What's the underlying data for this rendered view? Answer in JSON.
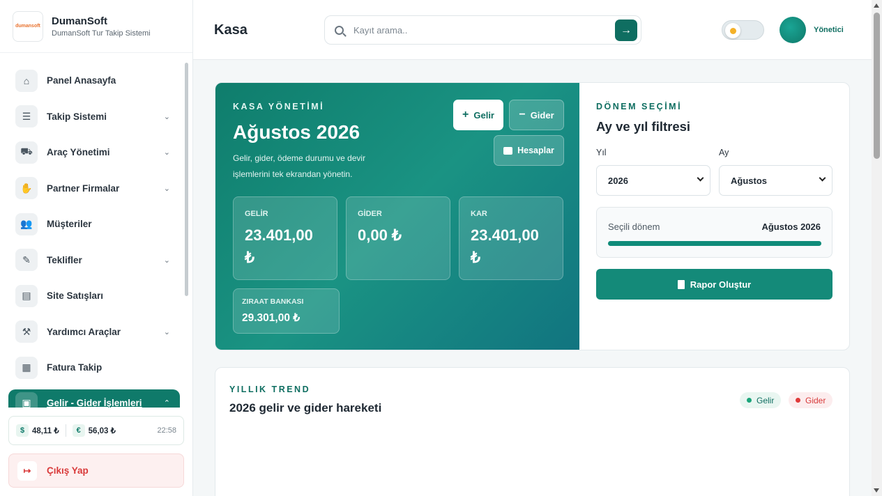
{
  "brand": {
    "logo_text": "dumansoft",
    "name": "DumanSoft",
    "subtitle": "DumanSoft Tur Takip Sistemi"
  },
  "sidebar": {
    "items": [
      {
        "label": "Panel Anasayfa",
        "icon": "home-icon",
        "glyph": "⌂",
        "chevron": ""
      },
      {
        "label": "Takip Sistemi",
        "icon": "list-icon",
        "glyph": "☰",
        "chevron": "⌄"
      },
      {
        "label": "Araç Yönetimi",
        "icon": "car-icon",
        "glyph": "⛟",
        "chevron": "⌄"
      },
      {
        "label": "Partner Firmalar",
        "icon": "handshake-icon",
        "glyph": "✋",
        "chevron": "⌄"
      },
      {
        "label": "Müşteriler",
        "icon": "users-icon",
        "glyph": "👥",
        "chevron": ""
      },
      {
        "label": "Teklifler",
        "icon": "edit-file-icon",
        "glyph": "✎",
        "chevron": "⌄"
      },
      {
        "label": "Site Satışları",
        "icon": "store-icon",
        "glyph": "▤",
        "chevron": ""
      },
      {
        "label": "Yardımcı Araçlar",
        "icon": "toolbox-icon",
        "glyph": "⚒",
        "chevron": "⌄"
      },
      {
        "label": "Fatura Takip",
        "icon": "invoice-icon",
        "glyph": "▦",
        "chevron": ""
      },
      {
        "label": "Gelir - Gider İşlemleri",
        "icon": "wallet-icon",
        "glyph": "▣",
        "chevron": "⌃"
      }
    ]
  },
  "rates": {
    "usd_symbol": "$",
    "usd": "48,11 ₺",
    "eur_symbol": "€",
    "eur": "56,03 ₺",
    "time": "22:58"
  },
  "logout": {
    "label": "Çıkış Yap",
    "glyph": "↦"
  },
  "header": {
    "title": "Kasa",
    "search_placeholder": "Kayıt arama..",
    "search_button": "→",
    "user_name": "Yönetici"
  },
  "kasa": {
    "eyebrow": "KASA YÖNETİMİ",
    "title": "Ağustos 2026",
    "description": "Gelir, gider, ödeme durumu ve devir işlemlerini tek ekrandan yönetin.",
    "btn_gelir_sym": "+",
    "btn_gelir": "Gelir",
    "btn_gider_sym": "−",
    "btn_gider": "Gider",
    "btn_hesaplar": "Hesaplar",
    "stats": [
      {
        "label": "GELİR",
        "value": "23.401,00 ₺"
      },
      {
        "label": "GİDER",
        "value": "0,00 ₺"
      },
      {
        "label": "KAR",
        "value": "23.401,00 ₺"
      }
    ],
    "bank": {
      "label": "ZIRAAT BANKASI",
      "value": "29.301,00 ₺"
    }
  },
  "filter": {
    "eyebrow": "DÖNEM SEÇİMİ",
    "title": "Ay ve yıl filtresi",
    "year_label": "Yıl",
    "year_value": "2026",
    "month_label": "Ay",
    "month_value": "Ağustos",
    "period_label": "Seçili dönem",
    "period_value": "Ağustos 2026",
    "period_progress": 1.0,
    "report_button": "Rapor Oluştur"
  },
  "trend": {
    "eyebrow": "YILLIK TREND",
    "title": "2026 gelir ve gider hareketi",
    "legend_gelir": "Gelir",
    "legend_gider": "Gider"
  },
  "colors": {
    "accent": "#0f7a6a",
    "income": "#1aa57a",
    "expense": "#e03a3a"
  }
}
